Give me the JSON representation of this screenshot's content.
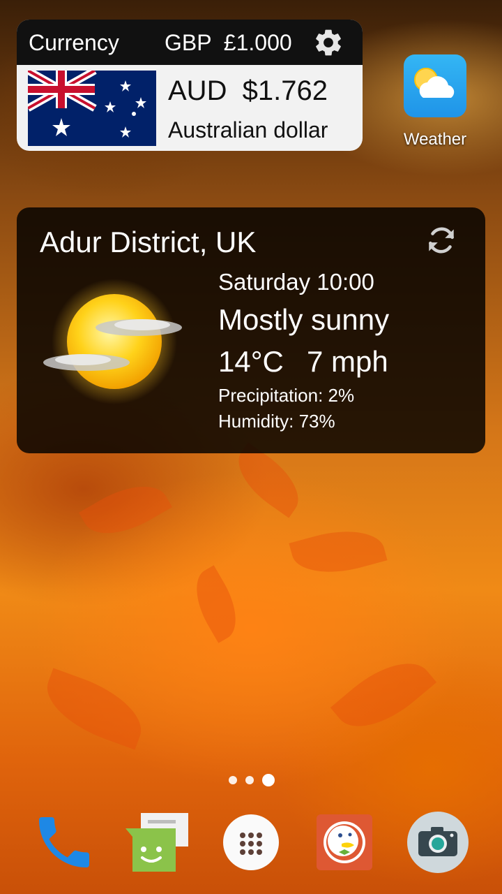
{
  "currency_widget": {
    "label": "Currency",
    "base": "GBP  £1.000",
    "target_rate": "AUD  $1.762",
    "target_name": "Australian dollar",
    "icons": {
      "settings": "gear-icon",
      "flag": "australia-flag"
    }
  },
  "apps": {
    "weather": {
      "label": "Weather",
      "icon": "weather-app-icon"
    }
  },
  "weather_widget": {
    "location": "Adur District, UK",
    "day_time": "Saturday 10:00",
    "condition": "Mostly sunny",
    "temperature": "14°C",
    "wind": "7 mph",
    "precipitation": "Precipitation: 2%",
    "humidity": "Humidity: 73%",
    "icons": {
      "refresh": "refresh-icon",
      "condition": "sun-cloud-icon"
    }
  },
  "home": {
    "page_count": 3,
    "active_page_index": 2
  },
  "dock": {
    "items": [
      {
        "icon": "phone-icon"
      },
      {
        "icon": "messages-icon"
      },
      {
        "icon": "app-drawer-icon"
      },
      {
        "icon": "duckduckgo-icon"
      },
      {
        "icon": "camera-icon"
      }
    ]
  },
  "colors": {
    "widget_dark": "#111111",
    "weather_blue": "#2aa6f0",
    "phone_blue": "#1e88e5",
    "messages_green": "#8bc34a",
    "duck_red": "#de5833"
  }
}
